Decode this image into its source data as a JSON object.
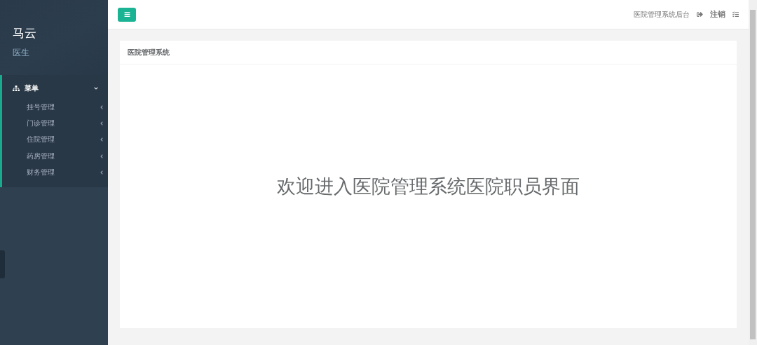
{
  "profile": {
    "name": "马云",
    "role": "医生"
  },
  "menu": {
    "label": "菜单",
    "expanded": true,
    "children": [
      {
        "label": "挂号管理",
        "expanded": false
      },
      {
        "label": "门诊管理",
        "expanded": false
      },
      {
        "label": "住院管理",
        "expanded": false
      },
      {
        "label": "药房管理",
        "expanded": false
      },
      {
        "label": "财务管理",
        "expanded": false
      }
    ]
  },
  "top_bar": {
    "system_name": "医院管理系统后台",
    "logout": "注销"
  },
  "panel": {
    "title": "医院管理系统",
    "welcome": "欢迎进入医院管理系统医院职员界面"
  }
}
